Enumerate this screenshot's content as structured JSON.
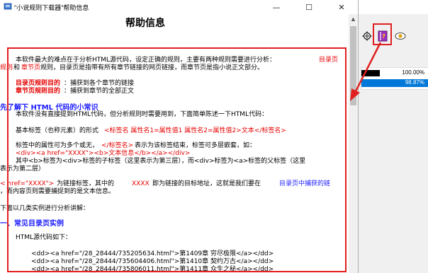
{
  "window": {
    "title": "\"小说规则下载器\"帮助信息",
    "minimize": "—",
    "maximize": "☐",
    "close": "✕"
  },
  "page": {
    "title": "帮助信息",
    "intro_1a": "本软件最大的难点在于分析HTML源代码，设定正确的规则，主要有两种规则需要进行分析：",
    "intro_1b": "目录页",
    "intro_2a": "规则",
    "intro_2b": "和",
    "intro_2c": "章节页",
    "intro_2d": "规则，目录页是指带有所有章节链接的网页链接，而章节页是指小说正文部分。",
    "goal_1_label": "目录页规则目的",
    "goal_1_text": "：捕获到各个章节的链接",
    "goal_2_label": "章节页规则目的",
    "goal_2_text": "：捕获到章节的全部正文",
    "section_html": "先了解下 HTML 代码的小常识",
    "p1": "本软件没有直接提到HTML代码，但分析规则时需要用到，下面简单陈述一下HTML代码：",
    "p2a": "基本标签（也称元素）的形式",
    "p2b": "<标签名 属性名1=属性值1 属性名2=属性值2>文本</标签名>",
    "p3a": "标签中的属性可为多个或无，",
    "p3b": "</标签名>",
    "p3c": "表示为该标签结束，标签可多层嵌套，如：",
    "p4": "<div><a href=\"XXXX\"><b>文本信息</b></a></div>",
    "p5": "其中<b>标签为<div>标签的子标签（这里表示为第三层），而<div>标签为<a>标签的父标签（这里",
    "p6": "表示为第二层）",
    "p7a": "< href=\"XXXX\">",
    "p7b": "为链接标签，其中的",
    "p7c": "XXXX",
    "p7d": "即为链接的目标地址，这就是我们要在",
    "p7e": "目录页中捕获的链",
    "p8": "，而内容页则需要捕捉到的是文本信息。",
    "p9": "下面以几类实例进行分析讲解：",
    "section_1": "一、常见目录页实例",
    "p10": "HTML源代码如下：",
    "code_1": "<dd><a href=\"/28_28444/735205634.html\">第1409章 穷尽极限</a></dd>",
    "code_2": "<dd><a href=\"/28_28444/735604406.html\">第1410章 契约万古</a></dd>",
    "code_3": "<dd><a href=\"/28_28444/735806011.html\">第1411章 众生之秘</a></dd>"
  },
  "bg_app": {
    "row_1_pct": "100.00%",
    "row_2_pct": "98.87%",
    "row_1_progress": 0.27,
    "row_2_progress": 0.9887,
    "accent": "#0078d7",
    "highlight": "#e02020"
  }
}
